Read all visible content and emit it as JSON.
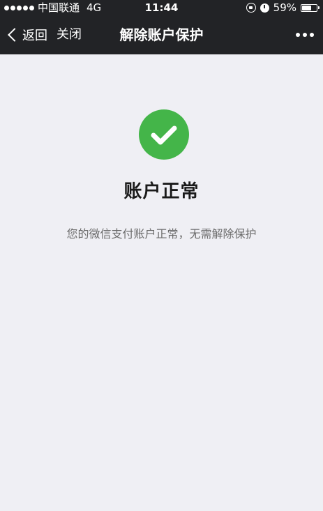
{
  "status_bar": {
    "carrier": "中国联通",
    "network": "4G",
    "time": "11:44",
    "battery_percent": "59%",
    "battery_level": 0.59,
    "icons": [
      "signal-dots-icon",
      "rotation-lock-icon",
      "alarm-icon",
      "battery-icon"
    ]
  },
  "nav": {
    "back_label": "返回",
    "close_label": "关闭",
    "title": "解除账户保护",
    "more_icon": "more-dots-icon"
  },
  "result": {
    "icon": "check-circle-icon",
    "icon_color": "#44b549",
    "title": "账户正常",
    "description": "您的微信支付账户正常，无需解除保护"
  },
  "colors": {
    "bar_background": "#222326",
    "page_background": "#efeff4"
  }
}
